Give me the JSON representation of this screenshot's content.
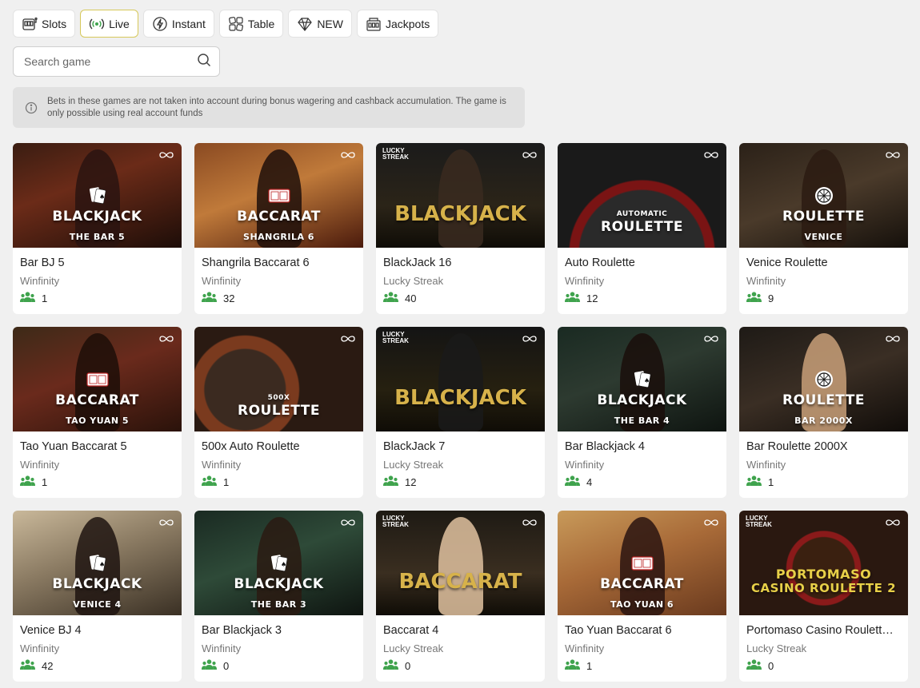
{
  "tabs": [
    {
      "label": "Slots",
      "icon": "slot-machine-icon",
      "active": false
    },
    {
      "label": "Live",
      "icon": "live-broadcast-icon",
      "active": true
    },
    {
      "label": "Instant",
      "icon": "lightning-icon",
      "active": false
    },
    {
      "label": "Table",
      "icon": "dice-icon",
      "active": false
    },
    {
      "label": "NEW",
      "icon": "diamond-icon",
      "active": false
    },
    {
      "label": "Jackpots",
      "icon": "jackpot-machine-icon",
      "active": false
    }
  ],
  "search": {
    "placeholder": "Search game",
    "value": ""
  },
  "notice": {
    "text": "Bets in these games are not taken into account during bonus wagering and cashback accumulation. The game is only possible using real account funds"
  },
  "colors": {
    "accent_green": "#3fa34d",
    "active_tab_border": "#d6c85a",
    "gold": "#d7b24a"
  },
  "games": [
    {
      "name": "Bar BJ 5",
      "provider": "Winfinity",
      "players": "1",
      "thumb_title": "BLACKJACK",
      "thumb_sub": "THE BAR 5"
    },
    {
      "name": "Shangrila Baccarat 6",
      "provider": "Winfinity",
      "players": "32",
      "thumb_title": "BACCARAT",
      "thumb_sub": "SHANGRILA 6"
    },
    {
      "name": "BlackJack 16",
      "provider": "Lucky Streak",
      "players": "40",
      "thumb_title": "BLACKJACK",
      "thumb_sub": ""
    },
    {
      "name": "Auto Roulette",
      "provider": "Winfinity",
      "players": "12",
      "thumb_title": "ROULETTE",
      "thumb_sub": "AUTOMATIC"
    },
    {
      "name": "Venice Roulette",
      "provider": "Winfinity",
      "players": "9",
      "thumb_title": "ROULETTE",
      "thumb_sub": "VENICE"
    },
    {
      "name": "Tao Yuan Baccarat 5",
      "provider": "Winfinity",
      "players": "1",
      "thumb_title": "BACCARAT",
      "thumb_sub": "TAO YUAN 5"
    },
    {
      "name": "500x Auto Roulette",
      "provider": "Winfinity",
      "players": "1",
      "thumb_title": "ROULETTE",
      "thumb_sub": "500X"
    },
    {
      "name": "BlackJack 7",
      "provider": "Lucky Streak",
      "players": "12",
      "thumb_title": "BLACKJACK",
      "thumb_sub": ""
    },
    {
      "name": "Bar Blackjack 4",
      "provider": "Winfinity",
      "players": "4",
      "thumb_title": "BLACKJACK",
      "thumb_sub": "THE BAR 4"
    },
    {
      "name": "Bar Roulette 2000X",
      "provider": "Winfinity",
      "players": "1",
      "thumb_title": "ROULETTE",
      "thumb_sub": "BAR 2000X"
    },
    {
      "name": "Venice BJ 4",
      "provider": "Winfinity",
      "players": "42",
      "thumb_title": "BLACKJACK",
      "thumb_sub": "VENICE 4"
    },
    {
      "name": "Bar Blackjack 3",
      "provider": "Winfinity",
      "players": "0",
      "thumb_title": "BLACKJACK",
      "thumb_sub": "THE BAR 3"
    },
    {
      "name": "Baccarat 4",
      "provider": "Lucky Streak",
      "players": "0",
      "thumb_title": "BACCARAT",
      "thumb_sub": ""
    },
    {
      "name": "Tao Yuan Baccarat 6",
      "provider": "Winfinity",
      "players": "1",
      "thumb_title": "BACCARAT",
      "thumb_sub": "TAO YUAN 6"
    },
    {
      "name": "Portomaso Casino Roulett…",
      "provider": "Lucky Streak",
      "players": "0",
      "thumb_title": "PORTOMASO",
      "thumb_sub": "CASINO ROULETTE 2"
    }
  ]
}
